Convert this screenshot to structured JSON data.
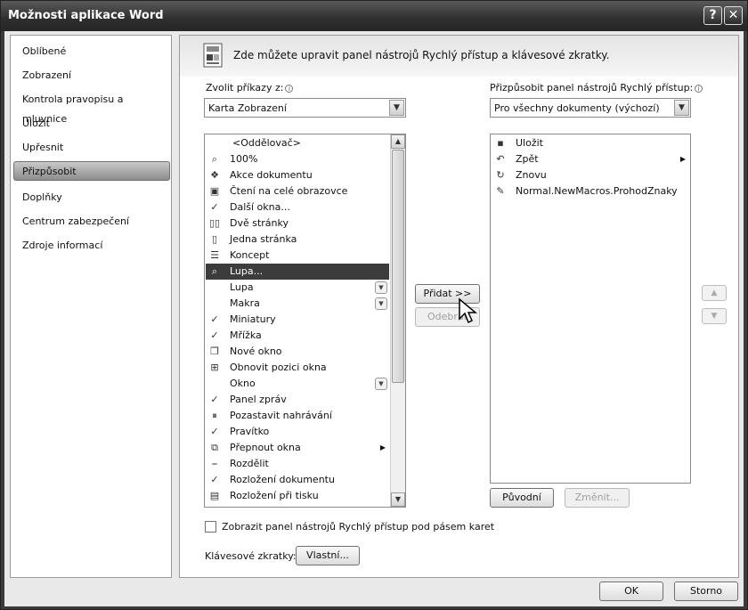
{
  "window": {
    "title": "Možnosti aplikace Word",
    "help_label": "?",
    "close_label": "✕"
  },
  "nav": {
    "items": [
      {
        "label": "Oblíbené",
        "active": false
      },
      {
        "label": "Zobrazení",
        "active": false
      },
      {
        "label": "Kontrola pravopisu a mluvnice",
        "active": false
      },
      {
        "label": "Uložit",
        "active": false
      },
      {
        "label": "Upřesnit",
        "active": false
      },
      {
        "label": "Přizpůsobit",
        "active": true
      },
      {
        "label": "Doplňky",
        "active": false
      },
      {
        "label": "Centrum zabezpečení",
        "active": false
      },
      {
        "label": "Zdroje informací",
        "active": false
      }
    ]
  },
  "banner": {
    "text": "Zde můžete upravit panel nástrojů Rychlý přístup a klávesové zkratky."
  },
  "choose_commands": {
    "label": "Zvolit příkazy z:",
    "value": "Karta Zobrazení"
  },
  "customize_qat": {
    "label": "Přizpůsobit panel nástrojů Rychlý přístup:",
    "value": "Pro všechny dokumenty (výchozí)"
  },
  "commands_list": [
    {
      "label": "<Oddělovač>",
      "icon": "",
      "arrow": "",
      "selected": false
    },
    {
      "label": "100%",
      "icon": "zoom-100-icon",
      "arrow": "",
      "selected": false
    },
    {
      "label": "Akce dokumentu",
      "icon": "document-actions-icon",
      "arrow": "",
      "selected": false
    },
    {
      "label": "Čtení na celé obrazovce",
      "icon": "full-screen-reading-icon",
      "arrow": "",
      "selected": false
    },
    {
      "label": "Další okna...",
      "icon": "check-icon",
      "arrow": "",
      "selected": false
    },
    {
      "label": "Dvě stránky",
      "icon": "two-pages-icon",
      "arrow": "",
      "selected": false
    },
    {
      "label": "Jedna stránka",
      "icon": "one-page-icon",
      "arrow": "",
      "selected": false
    },
    {
      "label": "Koncept",
      "icon": "draft-icon",
      "arrow": "",
      "selected": false
    },
    {
      "label": "Lupa...",
      "icon": "magnifier-icon",
      "arrow": "",
      "selected": true
    },
    {
      "label": "Lupa",
      "icon": "",
      "arrow": "dropdown",
      "selected": false
    },
    {
      "label": "Makra",
      "icon": "",
      "arrow": "dropdown",
      "selected": false
    },
    {
      "label": "Miniatury",
      "icon": "check-icon",
      "arrow": "",
      "selected": false
    },
    {
      "label": "Mřížka",
      "icon": "check-icon",
      "arrow": "",
      "selected": false
    },
    {
      "label": "Nové okno",
      "icon": "new-window-icon",
      "arrow": "",
      "selected": false
    },
    {
      "label": "Obnovit pozici okna",
      "icon": "reset-window-icon",
      "arrow": "",
      "selected": false
    },
    {
      "label": "Okno",
      "icon": "",
      "arrow": "dropdown",
      "selected": false
    },
    {
      "label": "Panel zpráv",
      "icon": "check-icon",
      "arrow": "",
      "selected": false
    },
    {
      "label": "Pozastavit nahrávání",
      "icon": "pause-recording-icon",
      "arrow": "",
      "selected": false
    },
    {
      "label": "Pravítko",
      "icon": "check-icon",
      "arrow": "",
      "selected": false
    },
    {
      "label": "Přepnout okna",
      "icon": "switch-windows-icon",
      "arrow": "submenu",
      "selected": false
    },
    {
      "label": "Rozdělit",
      "icon": "split-icon",
      "arrow": "",
      "selected": false
    },
    {
      "label": "Rozložení dokumentu",
      "icon": "check-icon",
      "arrow": "",
      "selected": false
    },
    {
      "label": "Rozložení při tisku",
      "icon": "print-layout-icon",
      "arrow": "",
      "selected": false
    }
  ],
  "qat_list": [
    {
      "label": "Uložit",
      "icon": "save-icon",
      "arrow": ""
    },
    {
      "label": "Zpět",
      "icon": "undo-icon",
      "arrow": "submenu"
    },
    {
      "label": "Znovu",
      "icon": "redo-icon",
      "arrow": ""
    },
    {
      "label": "Normal.NewMacros.ProhodZnaky",
      "icon": "macro-icon",
      "arrow": ""
    }
  ],
  "buttons": {
    "add_label": "Přidat >>",
    "remove_label": "Odebrat",
    "reset_label": "Původní",
    "modify_label": "Změnit...",
    "custom_label": "Vlastní...",
    "ok_label": "OK",
    "cancel_label": "Storno"
  },
  "show_below_ribbon": {
    "label": "Zobrazit panel nástrojů Rychlý přístup pod pásem karet",
    "checked": false
  },
  "keyboard_shortcuts": {
    "label": "Klávesové zkratky:"
  }
}
